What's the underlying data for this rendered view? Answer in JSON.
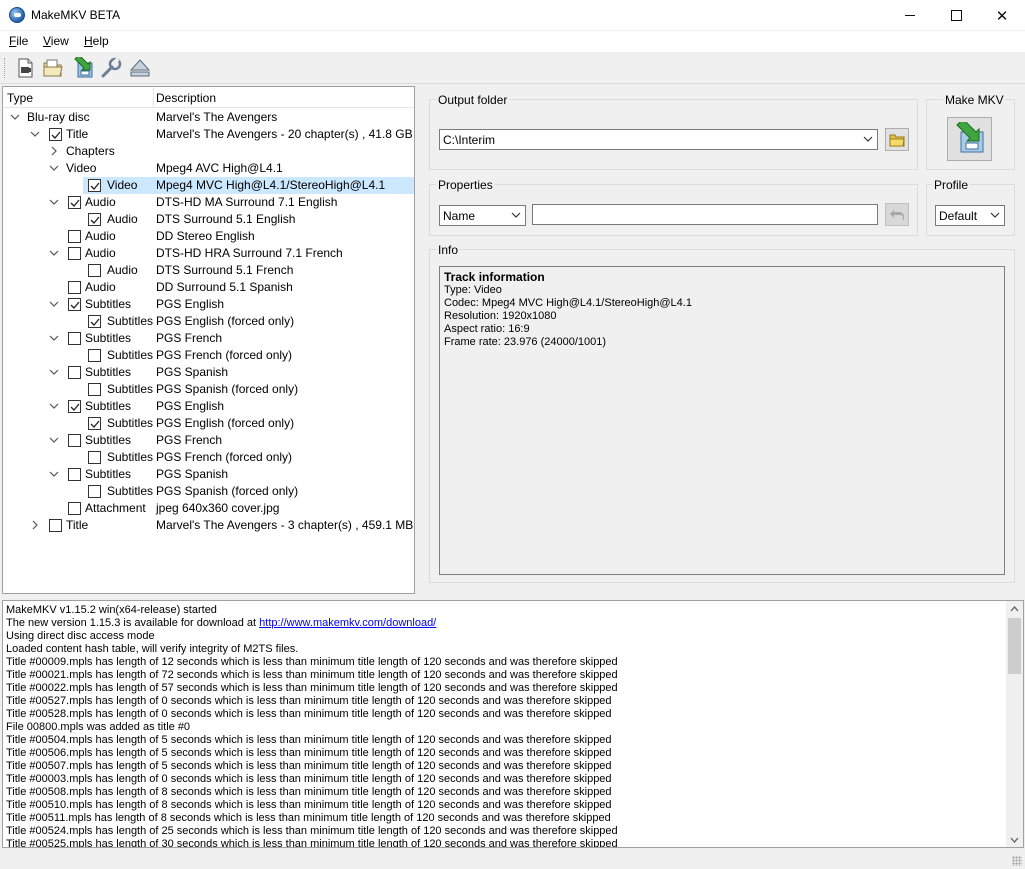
{
  "window": {
    "title": "MakeMKV BETA"
  },
  "menu": [
    {
      "label": "File",
      "key": "F",
      "rest": "ile"
    },
    {
      "label": "View",
      "key": "V",
      "rest": "iew"
    },
    {
      "label": "Help",
      "key": "H",
      "rest": "elp"
    }
  ],
  "toolbar": [
    "open-files-icon",
    "open-disc-icon",
    "backup-icon",
    "settings-wrench-icon",
    "eject-icon"
  ],
  "tree": {
    "header_type": "Type",
    "header_description": "Description",
    "rows": [
      {
        "type": "Blu-ray disc",
        "desc": "Marvel's The Avengers",
        "level": 0,
        "expander": "open",
        "check": "none"
      },
      {
        "type": "Title",
        "desc": "Marvel's The Avengers - 20 chapter(s) , 41.8 GB",
        "level": 1,
        "expander": "open",
        "check": "checked"
      },
      {
        "type": "Chapters",
        "desc": "",
        "level": 2,
        "expander": "closed",
        "check": "none"
      },
      {
        "type": "Video",
        "desc": "Mpeg4 AVC High@L4.1",
        "level": 2,
        "expander": "open",
        "check": "none"
      },
      {
        "type": "Video",
        "desc": "Mpeg4 MVC High@L4.1/StereoHigh@L4.1",
        "level": 3,
        "expander": "none",
        "check": "checked",
        "selected": true
      },
      {
        "type": "Audio",
        "desc": "DTS-HD MA Surround 7.1 English",
        "level": 2,
        "expander": "open",
        "check": "checked"
      },
      {
        "type": "Audio",
        "desc": "DTS Surround 5.1 English",
        "level": 3,
        "expander": "none",
        "check": "checked"
      },
      {
        "type": "Audio",
        "desc": "DD Stereo English",
        "level": 2,
        "expander": "none",
        "check": "unchecked"
      },
      {
        "type": "Audio",
        "desc": "DTS-HD HRA Surround 7.1 French",
        "level": 2,
        "expander": "open",
        "check": "unchecked"
      },
      {
        "type": "Audio",
        "desc": "DTS Surround 5.1 French",
        "level": 3,
        "expander": "none",
        "check": "unchecked"
      },
      {
        "type": "Audio",
        "desc": "DD Surround 5.1 Spanish",
        "level": 2,
        "expander": "none",
        "check": "unchecked"
      },
      {
        "type": "Subtitles",
        "desc": "PGS English",
        "level": 2,
        "expander": "open",
        "check": "checked"
      },
      {
        "type": "Subtitles",
        "desc": "PGS English  (forced only)",
        "level": 3,
        "expander": "none",
        "check": "checked"
      },
      {
        "type": "Subtitles",
        "desc": "PGS French",
        "level": 2,
        "expander": "open",
        "check": "unchecked"
      },
      {
        "type": "Subtitles",
        "desc": "PGS French  (forced only)",
        "level": 3,
        "expander": "none",
        "check": "unchecked"
      },
      {
        "type": "Subtitles",
        "desc": "PGS Spanish",
        "level": 2,
        "expander": "open",
        "check": "unchecked"
      },
      {
        "type": "Subtitles",
        "desc": "PGS Spanish  (forced only)",
        "level": 3,
        "expander": "none",
        "check": "unchecked"
      },
      {
        "type": "Subtitles",
        "desc": "PGS English",
        "level": 2,
        "expander": "open",
        "check": "checked"
      },
      {
        "type": "Subtitles",
        "desc": "PGS English  (forced only)",
        "level": 3,
        "expander": "none",
        "check": "checked"
      },
      {
        "type": "Subtitles",
        "desc": "PGS French",
        "level": 2,
        "expander": "open",
        "check": "unchecked"
      },
      {
        "type": "Subtitles",
        "desc": "PGS French  (forced only)",
        "level": 3,
        "expander": "none",
        "check": "unchecked"
      },
      {
        "type": "Subtitles",
        "desc": "PGS Spanish",
        "level": 2,
        "expander": "open",
        "check": "unchecked"
      },
      {
        "type": "Subtitles",
        "desc": "PGS Spanish  (forced only)",
        "level": 3,
        "expander": "none",
        "check": "unchecked"
      },
      {
        "type": "Attachment",
        "desc": "jpeg 640x360 cover.jpg",
        "level": 2,
        "expander": "none",
        "check": "unchecked"
      },
      {
        "type": "Title",
        "desc": "Marvel's The Avengers - 3 chapter(s) , 459.1 MB",
        "level": 1,
        "expander": "closed",
        "check": "unchecked"
      }
    ]
  },
  "output": {
    "label": "Output folder",
    "value": "C:\\Interim"
  },
  "make_mkv": {
    "label": "Make MKV"
  },
  "properties": {
    "label": "Properties",
    "select_value": "Name",
    "input_value": ""
  },
  "profile": {
    "label": "Profile",
    "value": "Default"
  },
  "info": {
    "label": "Info",
    "heading": "Track information",
    "lines": [
      "Type: Video",
      "Codec: Mpeg4 MVC High@L4.1/StereoHigh@L4.1",
      "Resolution: 1920x1080",
      "Aspect ratio: 16:9",
      "Frame rate: 23.976 (24000/1001)"
    ]
  },
  "log": {
    "lines": [
      "MakeMKV v1.15.2 win(x64-release) started",
      "The new version 1.15.3 is available for download at ",
      "Using direct disc access mode",
      "Loaded content hash table, will verify integrity of M2TS files.",
      "Title #00009.mpls has length of 12 seconds which is less than minimum title length of 120 seconds and was therefore skipped",
      "Title #00021.mpls has length of 72 seconds which is less than minimum title length of 120 seconds and was therefore skipped",
      "Title #00022.mpls has length of 57 seconds which is less than minimum title length of 120 seconds and was therefore skipped",
      "Title #00527.mpls has length of 0 seconds which is less than minimum title length of 120 seconds and was therefore skipped",
      "Title #00528.mpls has length of 0 seconds which is less than minimum title length of 120 seconds and was therefore skipped",
      "File 00800.mpls was added as title #0",
      "Title #00504.mpls has length of 5 seconds which is less than minimum title length of 120 seconds and was therefore skipped",
      "Title #00506.mpls has length of 5 seconds which is less than minimum title length of 120 seconds and was therefore skipped",
      "Title #00507.mpls has length of 5 seconds which is less than minimum title length of 120 seconds and was therefore skipped",
      "Title #00003.mpls has length of 0 seconds which is less than minimum title length of 120 seconds and was therefore skipped",
      "Title #00508.mpls has length of 8 seconds which is less than minimum title length of 120 seconds and was therefore skipped",
      "Title #00510.mpls has length of 8 seconds which is less than minimum title length of 120 seconds and was therefore skipped",
      "Title #00511.mpls has length of 8 seconds which is less than minimum title length of 120 seconds and was therefore skipped",
      "Title #00524.mpls has length of 25 seconds which is less than minimum title length of 120 seconds and was therefore skipped",
      "Title #00525.mpls has length of 30 seconds which is less than minimum title length of 120 seconds and was therefore skipped"
    ],
    "link_line_index": 1,
    "link_text": "http://www.makemkv.com/download/"
  }
}
